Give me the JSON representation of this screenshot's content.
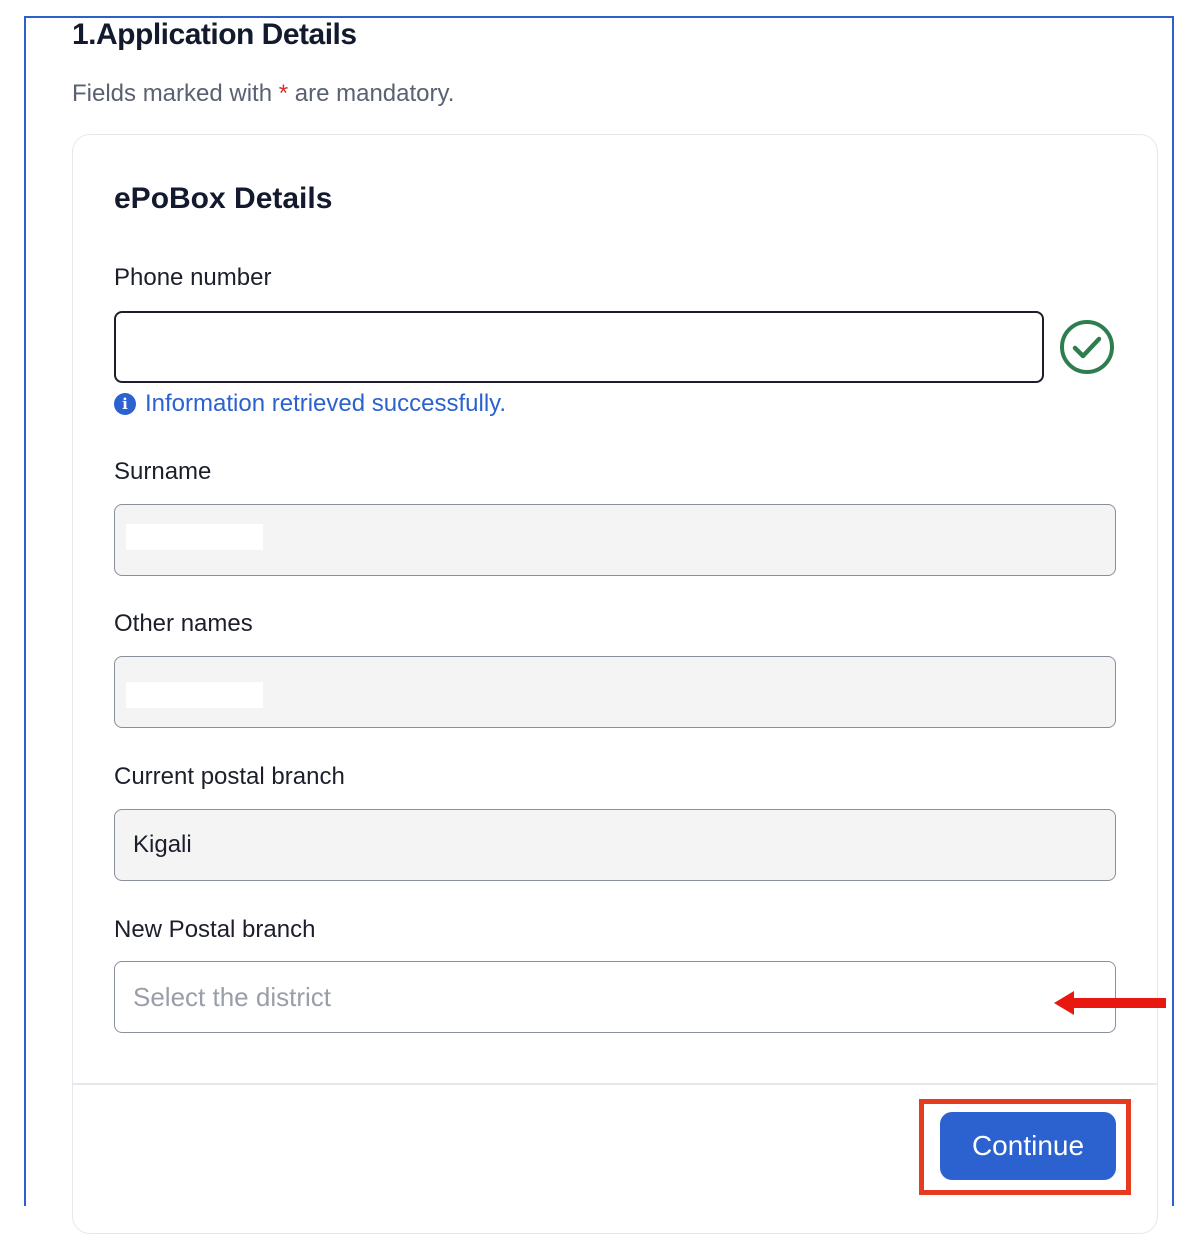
{
  "page": {
    "title": "1.Application Details",
    "mandatory_note_before": "Fields marked with ",
    "mandatory_asterisk": "*",
    "mandatory_note_after": " are mandatory."
  },
  "section": {
    "title": "ePoBox Details"
  },
  "fields": {
    "phone": {
      "label": "Phone number",
      "value": "",
      "status_icon": "check-circle-icon",
      "info_icon": "info-icon",
      "info_message": "Information retrieved successfully."
    },
    "surname": {
      "label": "Surname",
      "value": ""
    },
    "other_names": {
      "label": "Other names",
      "value": ""
    },
    "current_branch": {
      "label": "Current postal branch",
      "value": "Kigali"
    },
    "new_branch": {
      "label": "New Postal branch",
      "placeholder": "Select the district"
    }
  },
  "actions": {
    "continue_label": "Continue"
  },
  "colors": {
    "primary": "#2b62d0",
    "success": "#2e7d4f",
    "annotation_red": "#e53b1f",
    "frame_blue": "#2f5fc9"
  }
}
